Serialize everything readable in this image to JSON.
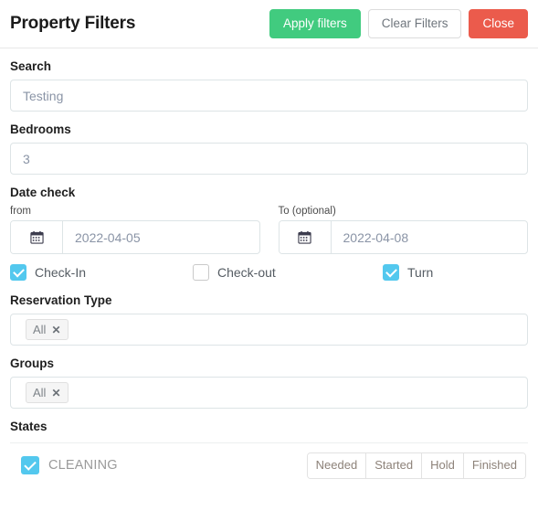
{
  "header": {
    "title": "Property Filters",
    "apply_label": "Apply filters",
    "clear_label": "Clear Filters",
    "close_label": "Close",
    "apply_color": "#41cb7f",
    "close_color": "#eb5b4c"
  },
  "search": {
    "label": "Search",
    "placeholder": "Testing",
    "value": ""
  },
  "bedrooms": {
    "label": "Bedrooms",
    "placeholder": "3",
    "value": ""
  },
  "date_check": {
    "label": "Date check",
    "from": {
      "label": "from",
      "value": "2022-04-05",
      "icon": "calendar-icon",
      "icon_glyph": "📅"
    },
    "to": {
      "label": "To (optional)",
      "value": "2022-04-08",
      "icon": "calendar-icon",
      "icon_glyph": "📅"
    },
    "checkboxes": [
      {
        "label": "Check-In",
        "checked": true
      },
      {
        "label": "Check-out",
        "checked": false
      },
      {
        "label": "Turn",
        "checked": true
      }
    ],
    "checked_color": "#53c8ee"
  },
  "reservation_type": {
    "label": "Reservation Type",
    "chips": [
      {
        "label": "All",
        "remove": "✕"
      }
    ]
  },
  "groups": {
    "label": "Groups",
    "chips": [
      {
        "label": "All",
        "remove": "✕"
      }
    ]
  },
  "states": {
    "label": "States",
    "rows": [
      {
        "name": "CLEANING",
        "checked": true,
        "segments": [
          "Needed",
          "Started",
          "Hold",
          "Finished"
        ]
      }
    ]
  }
}
